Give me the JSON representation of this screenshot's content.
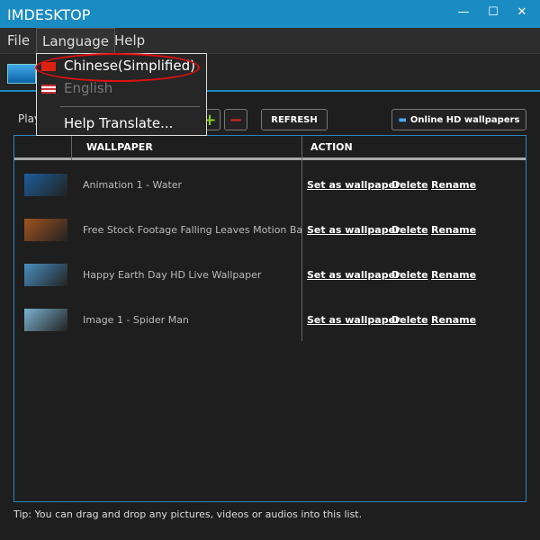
{
  "window": {
    "title": "IMDESKTOP",
    "minimize": "—",
    "maximize": "☐",
    "close": "✕"
  },
  "menu": [
    "File",
    "Language",
    "Help"
  ],
  "language_menu": {
    "items": [
      "Chinese(Simplified)",
      "English",
      "Help Translate..."
    ]
  },
  "toolbar": {
    "play_label": "Play",
    "add": "+",
    "remove": "−",
    "refresh": "REFRESH",
    "online": "Online HD wallpapers"
  },
  "table": {
    "headers": [
      "WALLPAPER",
      "ACTION"
    ],
    "rows": [
      {
        "name": "Animation 1 - Water",
        "thumb": "#1d5d9a"
      },
      {
        "name": "Free Stock Footage Falling Leaves Motion Background",
        "thumb": "#a0521e"
      },
      {
        "name": "Happy Earth Day HD Live Wallpaper",
        "thumb": "#4a8fc0"
      },
      {
        "name": "Image 1 - Spider Man",
        "thumb": "#7ab3d0"
      }
    ],
    "actions": [
      "Set as wallpaper",
      "Delete",
      "Rename"
    ]
  },
  "tip": "Tip: You can drag and drop any pictures, videos or audios into this list.",
  "colors": {
    "titlebar": "#1b8bc3",
    "highlight_ellipse": "#e01010"
  }
}
